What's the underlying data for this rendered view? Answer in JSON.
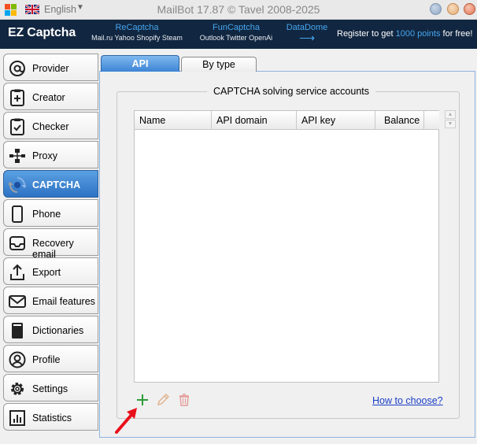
{
  "titlebar": {
    "language": "English",
    "app_title": "MailBot 17.87 © Tavel 2008-2025",
    "buttons": {
      "minimize": "◉",
      "maximize": "◉",
      "close": "◉"
    }
  },
  "banner": {
    "logo": "EZ Captcha",
    "col1": {
      "title": "ReCaptcha",
      "sub": "Mail.ru Yahoo Shopify Steam"
    },
    "col2": {
      "title": "FunCaptcha",
      "sub": "Outlook Twitter OpenAi"
    },
    "col3": {
      "title": "DataDome",
      "arrow": "⟶"
    },
    "register_prefix": "Register to get ",
    "register_highlight": "1000 points",
    "register_suffix": " for free!"
  },
  "sidebar": {
    "items": [
      {
        "label": "Provider",
        "icon": "at-icon"
      },
      {
        "label": "Creator",
        "icon": "add-document-icon"
      },
      {
        "label": "Checker",
        "icon": "checklist-icon"
      },
      {
        "label": "Proxy",
        "icon": "proxy-icon"
      },
      {
        "label": "CAPTCHA",
        "icon": "captcha-icon",
        "active": true
      },
      {
        "label": "Phone",
        "icon": "phone-icon"
      },
      {
        "label": "Recovery email",
        "icon": "inbox-icon"
      },
      {
        "label": "Export",
        "icon": "export-icon"
      },
      {
        "label": "Email features",
        "icon": "envelope-icon"
      },
      {
        "label": "Dictionaries",
        "icon": "book-icon"
      },
      {
        "label": "Profile",
        "icon": "user-icon"
      },
      {
        "label": "Settings",
        "icon": "gear-icon"
      },
      {
        "label": "Statistics",
        "icon": "bar-chart-icon"
      }
    ]
  },
  "tabs": {
    "api": "API",
    "by_type": "By type"
  },
  "main": {
    "group_title": "CAPTCHA solving service accounts",
    "columns": [
      "Name",
      "API domain",
      "API key",
      "Balance"
    ],
    "rows": [],
    "how_to_link": "How to choose?"
  },
  "colors": {
    "accent": "#3d84d6",
    "banner_bg": "#112640",
    "banner_accent": "#46a7f0",
    "add": "#2e9b3a",
    "delete": "#d9534f",
    "link": "#1a3ec8"
  }
}
